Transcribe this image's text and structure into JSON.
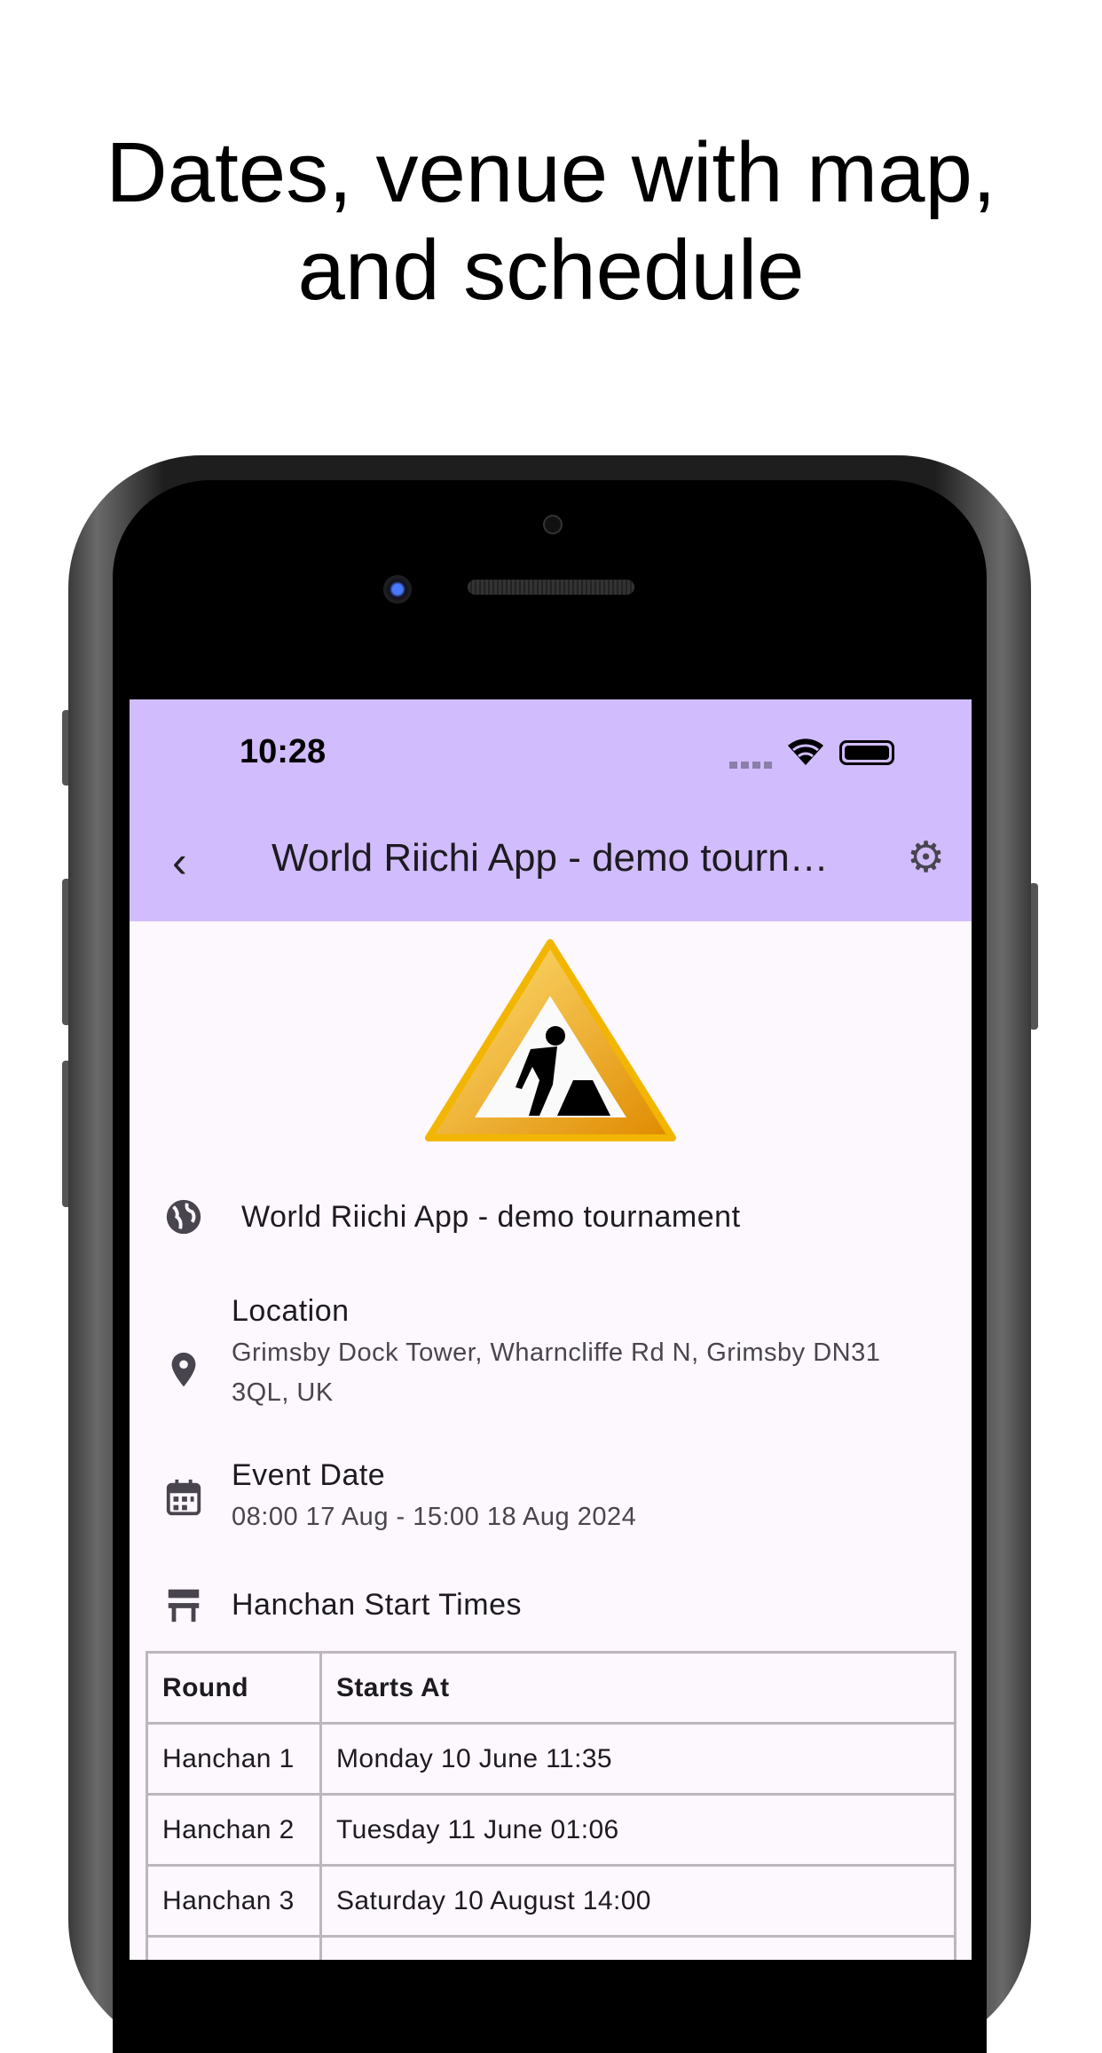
{
  "headline": {
    "line1": "Dates, venue with map,",
    "line2": "and schedule"
  },
  "status_bar": {
    "time": "10:28"
  },
  "app_bar": {
    "title": "World Riichi App - demo tournament",
    "back_icon": "chevron-left-icon",
    "settings_icon": "gear-icon"
  },
  "colors": {
    "app_bar": "#d1bcfd",
    "background": "#fdf7fe"
  },
  "details": {
    "name": "World Riichi App - demo tournament",
    "location_label": "Location",
    "location_address": "Grimsby Dock Tower, Wharncliffe Rd N, Grimsby DN31 3QL, UK",
    "date_label": "Event Date",
    "date_value": "08:00 17 Aug - 15:00 18 Aug 2024",
    "schedule_label": "Hanchan Start Times"
  },
  "table": {
    "headers": [
      "Round",
      "Starts At"
    ],
    "rows": [
      [
        "Hanchan 1",
        "Monday 10 June 11:35"
      ],
      [
        "Hanchan 2",
        "Tuesday 11 June 01:06"
      ],
      [
        "Hanchan 3",
        "Saturday 10 August 14:00"
      ]
    ]
  }
}
